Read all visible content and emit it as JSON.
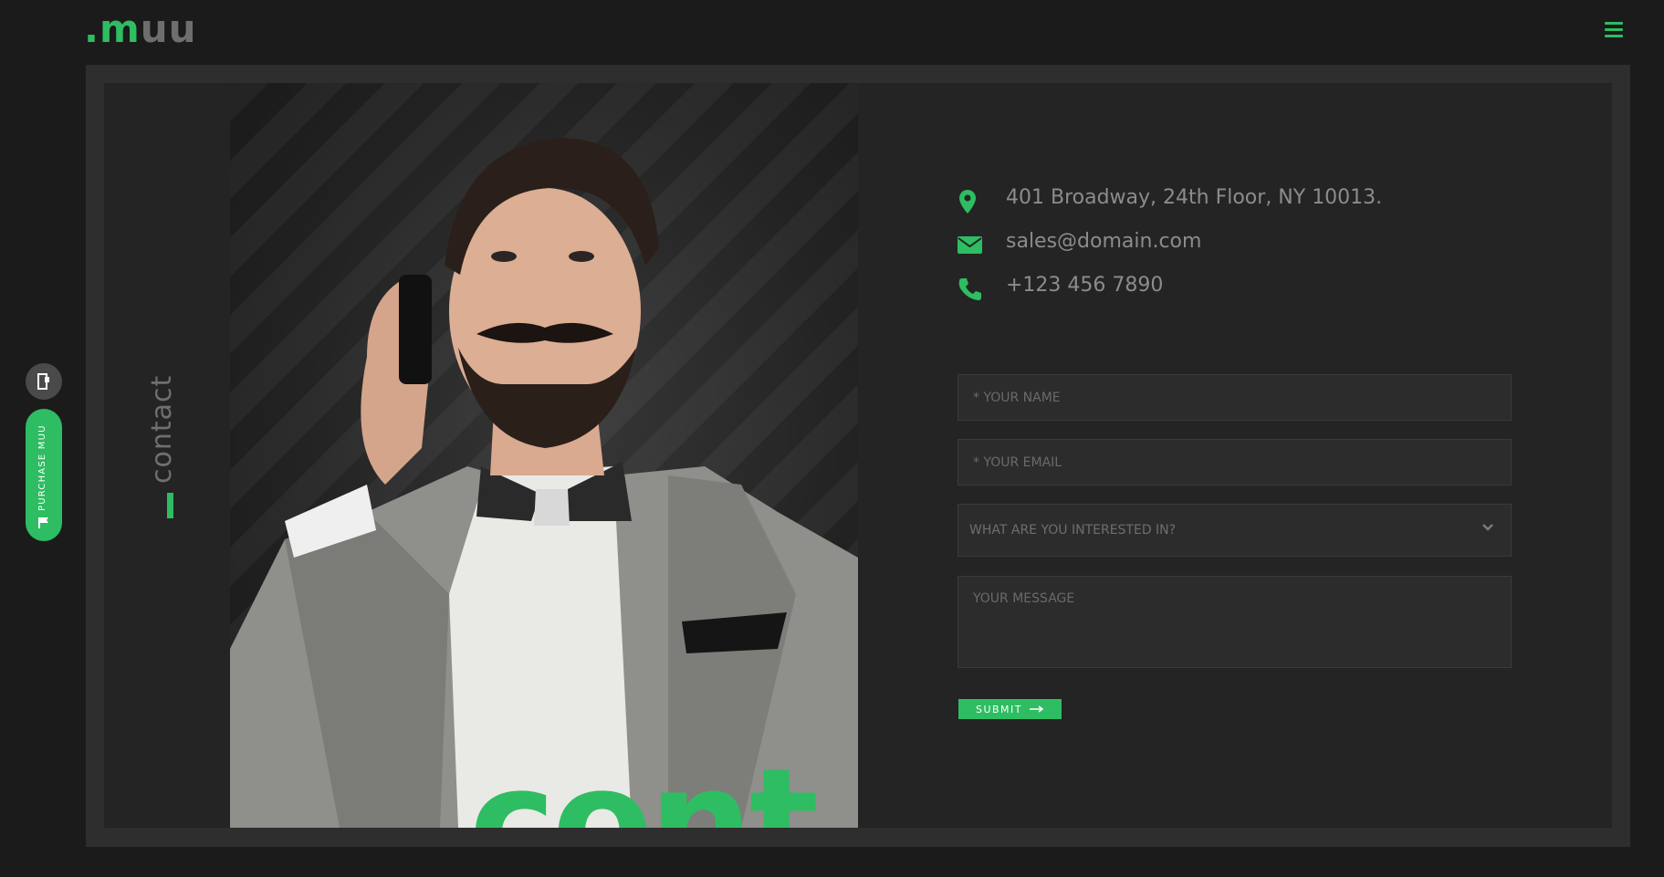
{
  "header": {
    "logo_dot": ".",
    "logo_m": "m",
    "logo_uu": "uu",
    "menu_icon": "hamburger-menu-icon"
  },
  "section": {
    "side_label": "contact",
    "photo_overlay_text": "cont"
  },
  "contact_info": {
    "address": "401 Broadway, 24th Floor, NY 10013.",
    "email": "sales@domain.com",
    "phone": "+123 456 7890",
    "icons": [
      "map-pin-icon",
      "envelope-icon",
      "phone-icon"
    ]
  },
  "form": {
    "name_placeholder": "* YOUR NAME",
    "email_placeholder": "* YOUR EMAIL",
    "interest_selected": "WHAT ARE YOU INTERESTED IN?",
    "message_placeholder": "YOUR MESSAGE",
    "submit_label": "SUBMIT"
  },
  "floating": {
    "purchase_label": "PURCHASE MUU"
  },
  "colors": {
    "accent": "#2ebd62",
    "background": "#1b1b1b",
    "panel": "#242424",
    "frame": "#2e2e2e"
  }
}
